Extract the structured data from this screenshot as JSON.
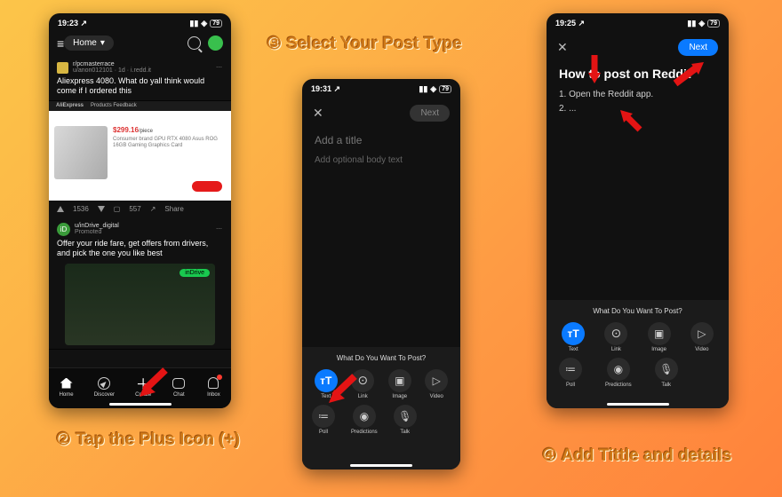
{
  "captions": {
    "step2": "② Tap the Plus Icon (+)",
    "step3": "③ Select Your Post Type",
    "step4": "④ Add Tittle and details"
  },
  "phone1": {
    "time": "19:23",
    "battery": "79",
    "menu_icon": "≡",
    "home_label": "Home",
    "post1": {
      "subreddit": "r/pcmasterrace",
      "byline": "u/anon012101 · 1d · i.redd.it",
      "title": "Aliexpress 4080. What do yall think would come if I ordered this",
      "preview_bar_brand": "AliExpress",
      "preview_tabs": "Products   Feedback",
      "price": "$299.16",
      "price_suffix": "/piece",
      "desc": "Consumer brand GPU RTX 4080 Asus ROG 16GB Gaming Graphics Card"
    },
    "actions": {
      "up": "1536",
      "comments": "557",
      "share": "Share"
    },
    "post2": {
      "user": "u/inDrive_digital",
      "tag": "Promoted",
      "text": "Offer your ride fare, get offers from drivers, and pick the one you like best",
      "badge": "inDrive"
    },
    "nav": {
      "home": "Home",
      "discover": "Discover",
      "create": "Create",
      "chat": "Chat",
      "inbox": "Inbox"
    }
  },
  "compose": {
    "time2": "19:31",
    "time3": "19:25",
    "battery": "79",
    "next": "Next",
    "title_placeholder": "Add a title",
    "body_placeholder": "Add optional body text",
    "filled_title": "How to post on Reddit",
    "filled_body_l1": "1. Open the Reddit app.",
    "filled_body_l2": "2. ...",
    "tray_head": "What Do You Want To Post?",
    "opts": {
      "text": "Text",
      "link": "Link",
      "image": "Image",
      "video": "Video",
      "poll": "Poll",
      "pred": "Predictions",
      "talk": "Talk"
    }
  }
}
